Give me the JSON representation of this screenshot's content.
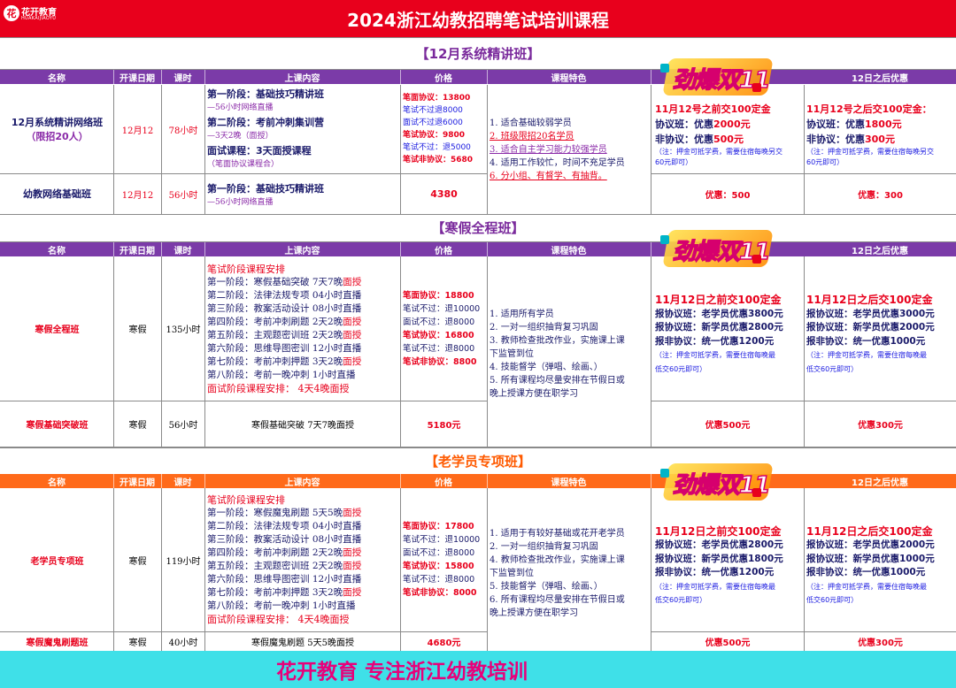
{
  "header": {
    "title": "2024浙江幼教招聘笔试培训课程",
    "logo_cn": "花开教育",
    "logo_en": "HUAKAIJIAOYU",
    "logo_mark": "花"
  },
  "columns": [
    "名称",
    "开课日期",
    "课时",
    "上课内容",
    "价格",
    "课程特色",
    "",
    "12日之后优惠"
  ],
  "badge_text": "劲爆双11",
  "section1": {
    "banner": "【12月系统精讲班】",
    "row1": {
      "name_lines": [
        "12月系统精讲网络班",
        "（限招20人）"
      ],
      "date": "12月12",
      "hours": "78小时",
      "content": [
        {
          "t": "第一阶段：基础技巧精讲班",
          "c": "dark"
        },
        {
          "t": "—56小时网络直播",
          "c": "purple"
        },
        {
          "t": "第二阶段：考前冲刺集训营",
          "c": "dark"
        },
        {
          "t": "—3天2晚（面授）",
          "c": "purple"
        },
        {
          "t": "面试课程：3天面授课程",
          "c": "dark"
        },
        {
          "t": "（笔面协议课程合）",
          "c": "purple"
        }
      ],
      "price": [
        {
          "t": "笔面协议：13800",
          "c": "red"
        },
        {
          "t": "笔试不过退8000",
          "c": "blue"
        },
        {
          "t": "面试不过退6000",
          "c": "blue"
        },
        {
          "t": "笔试协议：9800",
          "c": "red"
        },
        {
          "t": "笔试不过：退5000",
          "c": "blue"
        },
        {
          "t": "笔试非协议：5680",
          "c": "red"
        }
      ],
      "before": [
        {
          "t": "11月12号之前交100定金",
          "c": "red"
        },
        {
          "t": "协议班：优惠2000元",
          "c": "mix",
          "a": "协议班：优惠",
          "b": "2000元"
        },
        {
          "t": "非协议：优惠500元",
          "c": "mix",
          "a": "非协议：优惠",
          "b": "500元"
        },
        {
          "t": "（注：押金可抵学费，需要住宿每晚另交",
          "c": "blue"
        },
        {
          "t": "60元即可）",
          "c": "blue"
        }
      ],
      "after": [
        {
          "t": "11月12号之后交100定金：",
          "c": "red"
        },
        {
          "t": "协议班：优惠1800元",
          "c": "mix",
          "a": "协议班：优惠",
          "b": "1800元"
        },
        {
          "t": "非协议：优惠300元",
          "c": "mix",
          "a": "非协议：优惠",
          "b": "300元"
        },
        {
          "t": "（注：押金可抵学费，需要住宿每晚另交",
          "c": "blue"
        },
        {
          "t": "60元即可）",
          "c": "blue"
        }
      ]
    },
    "features": [
      {
        "t": "1. 适合基础较弱学员",
        "c": "dark"
      },
      {
        "t": "2. 班级限招20名学员",
        "c": "red"
      },
      {
        "t": "3. 适合自主学习能力较强学员",
        "c": "purple"
      },
      {
        "t": "4. 适用工作较忙，时间不充足学员",
        "c": "dark"
      },
      {
        "t": "6. 分小组、有督学、有抽背。",
        "c": "red"
      }
    ],
    "row2": {
      "name": "幼教网络基础班",
      "date": "12月12",
      "hours": "56小时",
      "content": [
        {
          "t": "第一阶段：基础技巧精讲班",
          "c": "dark"
        },
        {
          "t": "—56小时网络直播",
          "c": "purple"
        }
      ],
      "price": "4380",
      "before": "优惠：500",
      "after": "优惠：300"
    }
  },
  "section2": {
    "banner": "【寒假全程班】",
    "row1": {
      "name": "寒假全程班",
      "date": "寒假",
      "hours": "135小时",
      "content_title": "笔试阶段课程安排",
      "content": [
        {
          "s": "第一阶段：寒假基础突破  7天7晚",
          "e": "面授"
        },
        {
          "s": "第二阶段：法律法规专项  04小时直播",
          "e": ""
        },
        {
          "s": "第三阶段：教案活动设计  08小时直播",
          "e": ""
        },
        {
          "s": "第四阶段：考前冲刺刷题  2天2晚",
          "e": "面授"
        },
        {
          "s": "第五阶段：主观题密训班  2天2晚",
          "e": "面授"
        },
        {
          "s": "第六阶段：思维导图密训  12小时直播",
          "e": ""
        },
        {
          "s": "第七阶段：考前冲刺押题  3天2晚",
          "e": "面授"
        },
        {
          "s": "第八阶段：考前一晚冲刺  1小时直播",
          "e": ""
        }
      ],
      "content_footer": "面试阶段课程安排：  4天4晚面授",
      "price": [
        {
          "t": "笔面协议：18800",
          "c": "red"
        },
        {
          "t": "笔试不过：退10000",
          "c": "dark"
        },
        {
          "t": "面试不过：退8000",
          "c": "dark"
        },
        {
          "t": "笔试协议：16800",
          "c": "red"
        },
        {
          "t": "笔试不过：退8000",
          "c": "dark"
        },
        {
          "t": "笔试非协议：8800",
          "c": "red"
        }
      ],
      "before": [
        {
          "t": "11月12日之前交100定金",
          "c": "red"
        },
        {
          "t": "报协议班：老学员优惠3800元",
          "c": "dark"
        },
        {
          "t": "报协议班：新学员优惠2800元",
          "c": "dark"
        },
        {
          "t": "报非协议：统一优惠1200元",
          "c": "dark"
        },
        {
          "t": "（注：押金可抵学费，需要住宿每晚最",
          "c": "blue"
        },
        {
          "t": "低交60元即可）",
          "c": "blue"
        }
      ],
      "after": [
        {
          "t": "11月12日之后交100定金",
          "c": "red"
        },
        {
          "t": "报协议班：老学员优惠3000元",
          "c": "dark"
        },
        {
          "t": "报协议班：新学员优惠2000元",
          "c": "dark"
        },
        {
          "t": "报非协议：统一优惠1000元",
          "c": "dark"
        },
        {
          "t": "（注：押金可抵学费，需要住宿每晚最",
          "c": "blue"
        },
        {
          "t": "低交60元即可）",
          "c": "blue"
        }
      ]
    },
    "features": [
      {
        "t": "1. 适用所有学员",
        "c": "dark"
      },
      {
        "t": "2. 一对一组织抽背复习巩固",
        "c": "dark"
      },
      {
        "t": "3. 教师检查批改作业，实施课上课",
        "c": "dark"
      },
      {
        "t": "下监管到位",
        "c": "dark"
      },
      {
        "t": "4. 技能督学（弹唱、绘画、）",
        "c": "dark"
      },
      {
        "t": "5. 所有课程均尽量安排在节假日或",
        "c": "dark"
      },
      {
        "t": "晚上授课方便在职学习",
        "c": "dark"
      }
    ],
    "row2": {
      "name": "寒假基础突破班",
      "date": "寒假",
      "hours": "56小时",
      "content": "寒假基础突破  7天7晚面授",
      "price": "5180元",
      "before": "优惠500元",
      "after": "优惠300元"
    }
  },
  "section3": {
    "banner": "【老学员专项班】",
    "row1": {
      "name": "老学员专项班",
      "date": "寒假",
      "hours": "119小时",
      "content_title": "笔试阶段课程安排",
      "content": [
        {
          "s": "第一阶段：寒假魔鬼刷题  5天5晚",
          "e": "面授"
        },
        {
          "s": "第二阶段：法律法规专项  04小时直播",
          "e": ""
        },
        {
          "s": "第三阶段：教案活动设计  08小时直播",
          "e": ""
        },
        {
          "s": "第四阶段：考前冲刺刷题  2天2晚",
          "e": "面授"
        },
        {
          "s": "第五阶段：主观题密训班  2天2晚",
          "e": "面授"
        },
        {
          "s": "第六阶段：思维导图密训  12小时直播",
          "e": ""
        },
        {
          "s": "第七阶段：考前冲刺押题  3天2晚",
          "e": "面授"
        },
        {
          "s": "第八阶段：考前一晚冲刺  1小时直播",
          "e": ""
        }
      ],
      "content_footer": "面试阶段课程安排：  4天4晚面授",
      "price": [
        {
          "t": "笔面协议：17800",
          "c": "red"
        },
        {
          "t": "笔试不过：退10000",
          "c": "dark"
        },
        {
          "t": "面试不过：退8000",
          "c": "dark"
        },
        {
          "t": "笔试协议：15800",
          "c": "red"
        },
        {
          "t": "笔试不过：退8000",
          "c": "dark"
        },
        {
          "t": "笔试非协议：8000",
          "c": "red"
        }
      ],
      "before": [
        {
          "t": "11月12日之前交100定金",
          "c": "red"
        },
        {
          "t": "报协议班：老学员优惠2800元",
          "c": "dark"
        },
        {
          "t": "报协议班：新学员优惠1800元",
          "c": "dark"
        },
        {
          "t": "报非协议：统一优惠1200元",
          "c": "dark"
        },
        {
          "t": "（注：押金可抵学费，需要住宿每晚最",
          "c": "blue"
        },
        {
          "t": "低交60元即可）",
          "c": "blue"
        }
      ],
      "after": [
        {
          "t": "11月12日之后交100定金",
          "c": "red"
        },
        {
          "t": "报协议班：老学员优惠2000元",
          "c": "dark"
        },
        {
          "t": "报协议班：新学员优惠1000元",
          "c": "dark"
        },
        {
          "t": "报非协议：统一优惠1000元",
          "c": "dark"
        },
        {
          "t": "（注：押金可抵学费，需要住宿每晚最",
          "c": "blue"
        },
        {
          "t": "低交60元即可）",
          "c": "blue"
        }
      ]
    },
    "features": [
      {
        "t": "1. 适用于有较好基础或花开老学员",
        "c": "dark"
      },
      {
        "t": "2. 一对一组织抽背复习巩固",
        "c": "dark"
      },
      {
        "t": "4. 教师检查批改作业，实施课上课",
        "c": "dark"
      },
      {
        "t": "下监管到位",
        "c": "dark"
      },
      {
        "t": "5. 技能督学（弹唱、绘画、）",
        "c": "dark"
      },
      {
        "t": "6. 所有课程均尽量安排在节假日或",
        "c": "dark"
      },
      {
        "t": "晚上授课方便在职学习",
        "c": "dark"
      }
    ],
    "row2": {
      "name": "寒假魔鬼刷题班",
      "date": "寒假",
      "hours": "40小时",
      "content": "寒假魔鬼刷题  5天5晚面授",
      "price": "4680元",
      "before": "优惠500元",
      "after": "优惠300元"
    }
  },
  "footer": {
    "text": "花开教育  专注浙江幼教培训"
  },
  "colors": {
    "red": "#e8001c",
    "purple_header": "#7b3ba8",
    "orange_header": "#ff6a1a",
    "section_bg": "#ffffff",
    "banner_text": "#7a2a9c",
    "banner_text3": "#ff5a00",
    "footer_bg": "#3fe0e8",
    "footer_text": "#e8007a"
  }
}
